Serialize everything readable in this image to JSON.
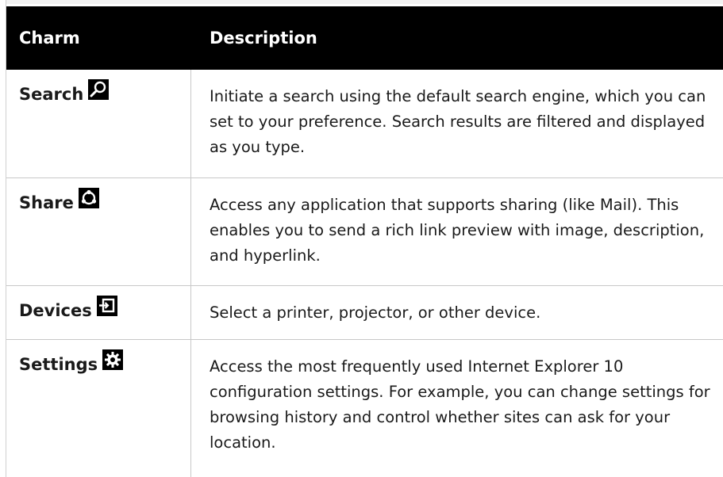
{
  "table": {
    "headers": {
      "charm": "Charm",
      "description": "Description"
    },
    "rows": [
      {
        "charm": "Search",
        "icon": "search-icon",
        "description": "Initiate a search using the default search engine, which you can set to your preference. Search results are filtered and displayed as you type."
      },
      {
        "charm": "Share",
        "icon": "share-icon",
        "description": "Access any application that supports sharing (like Mail). This enables you to send a rich link preview with image, description, and hyperlink."
      },
      {
        "charm": "Devices",
        "icon": "devices-icon",
        "description": "Select a printer, projector, or other device."
      },
      {
        "charm": "Settings",
        "icon": "settings-icon",
        "description": "Access the most frequently used Internet Explorer 10 configuration settings. For example, you can change settings for browsing history and control whether sites can ask for your location."
      }
    ]
  },
  "colors": {
    "header_bg": "#000000",
    "header_text": "#ffffff",
    "rule": "#c8c8c8",
    "body_text": "#1a1a1a"
  }
}
